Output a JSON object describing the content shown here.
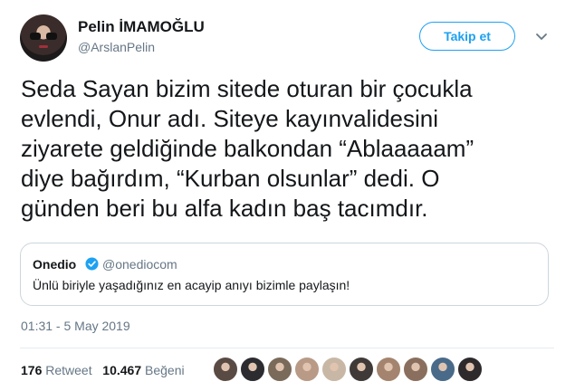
{
  "author": {
    "name": "Pelin İMAMOĞLU",
    "handle": "@ArslanPelin"
  },
  "follow_label": "Takip et",
  "tweet": {
    "lines": [
      "Seda Sayan bizim sitede oturan bir çocukla",
      "evlendi, Onur adı. Siteye kayınvalidesini",
      "ziyarete geldiğinde balkondan “Ablaaaaam”",
      "diye bağırdım, “Kurban olsunlar” dedi. O",
      "günden beri bu alfa kadın baş tacımdır."
    ]
  },
  "quote": {
    "name": "Onedio",
    "handle": "@onediocom",
    "text": "Ünlü biriyle yaşadığınız en acayip anıyı bizimle paylaşın!"
  },
  "timestamp": "01:31 - 5 May 2019",
  "stats": {
    "retweets_count": "176",
    "retweets_label": "Retweet",
    "likes_count": "10.467",
    "likes_label": "Beğeni"
  },
  "colors": {
    "accent": "#1da1f2",
    "text": "#14171a",
    "muted": "#657786",
    "border": "#ccd6dd"
  },
  "likers": [
    {
      "icon": "liker-avatar",
      "color": "#5a4a44"
    },
    {
      "icon": "liker-avatar",
      "color": "#2b2b30"
    },
    {
      "icon": "liker-avatar",
      "color": "#7a6a5a"
    },
    {
      "icon": "liker-avatar",
      "color": "#b89a86"
    },
    {
      "icon": "liker-avatar",
      "color": "#c9b7a6"
    },
    {
      "icon": "liker-avatar",
      "color": "#3f3a38"
    },
    {
      "icon": "liker-avatar",
      "color": "#a4846e"
    },
    {
      "icon": "liker-avatar",
      "color": "#8a6f5e"
    },
    {
      "icon": "liker-avatar",
      "color": "#4a6a8a"
    },
    {
      "icon": "liker-avatar",
      "color": "#2e2a2c"
    }
  ]
}
